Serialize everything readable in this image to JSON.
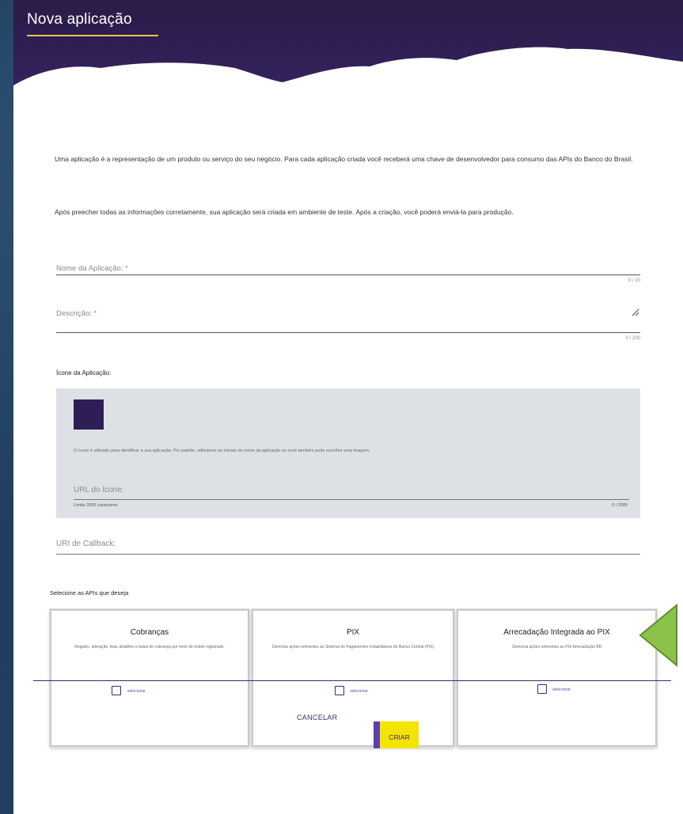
{
  "header": {
    "title": "Nova aplicação"
  },
  "intro": {
    "paragraph1": "Uma aplicação é a representação de um produto ou serviço do seu negócio. Para cada aplicação criada você receberá uma chave de desenvolvedor para consumo das APIs do Banco do Brasil.",
    "paragraph2": "Após preecher todas as informações corretamente, sua aplicação será criada em ambiente de teste. Após a criação, você poderá enviá-la para produção."
  },
  "form": {
    "name_label": "Nome da Aplicação: *",
    "name_counter": "0 / 20",
    "description_label": "Descrição: *",
    "description_counter": "0 / 200",
    "icon_section_title": "Ícone da Aplicação:",
    "icon_help": "O ícone é utilizado para identificar a sua aplicação. Por padrão, utilizamos as iniciais do nome da aplicação ou você também pode escolher uma imagem.",
    "icon_url_label": "URL do Ícone:",
    "icon_url_limit": "Limite 2000 caracteres",
    "icon_url_counter": "0 / 2000",
    "callback_label": "URI de Callback:"
  },
  "apis": {
    "section_title": "Selecione as APIs que deseja",
    "cards": [
      {
        "title": "Cobranças",
        "description": "Registro, alteração, lista, detalhes e baixa de cobrança por meio de boleto registrado.",
        "select_label": "selecionar"
      },
      {
        "title": "PIX",
        "description": "Gerencia ações referentes ao Sistema de Pagamentos Instantâneos do Banco Central (PIX)",
        "select_label": "selecionar"
      },
      {
        "title": "Arrecadação Integrada ao PIX",
        "description": "Gerencia ações referentes ao PIX Arrecadação BB",
        "select_label": "selecionar"
      }
    ]
  },
  "actions": {
    "cancel_label": "CANCELAR",
    "create_label": "CRIAR"
  },
  "colors": {
    "header_bg": "#2a1b47",
    "accent_yellow": "#f4e300",
    "accent_purple": "#5b3fb0",
    "arrow_green": "#8bc34a"
  }
}
